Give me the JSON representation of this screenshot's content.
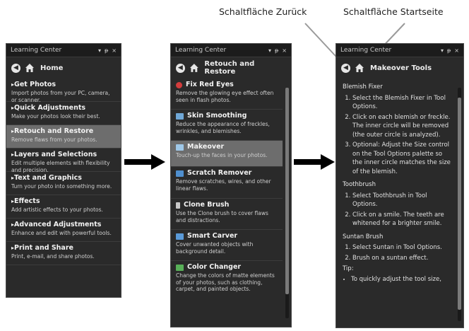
{
  "callouts": {
    "back_label": "Schaltfläche Zurück",
    "home_label": "Schaltfläche Startseite"
  },
  "panel_common": {
    "title": "Learning Center",
    "pin_glyph": "▾",
    "dock_glyph": "ᵽ",
    "close_glyph": "×"
  },
  "panel1": {
    "nav_title": "Home",
    "items": [
      {
        "title": "Get Photos",
        "desc": "Import photos from your PC, camera, or scanner."
      },
      {
        "title": "Quick Adjustments",
        "desc": "Make your photos look their best."
      },
      {
        "title": "Retouch and Restore",
        "desc": "Remove flaws from your photos."
      },
      {
        "title": "Layers and Selections",
        "desc": "Edit multiple elements with flexibility and precision."
      },
      {
        "title": "Text and Graphics",
        "desc": "Turn your photo into something more."
      },
      {
        "title": "Effects",
        "desc": "Add artistic effects to your photos."
      },
      {
        "title": "Advanced Adjustments",
        "desc": "Enhance and edit with powerful tools."
      },
      {
        "title": "Print and Share",
        "desc": "Print, e-mail, and share photos."
      }
    ]
  },
  "panel2": {
    "nav_title": "Retouch and Restore",
    "items": [
      {
        "title": "Fix Red Eyes",
        "desc": "Remove the glowing eye effect often seen in flash photos.",
        "icon": "red-eye-icon",
        "color": "#d23c3c"
      },
      {
        "title": "Skin Smoothing",
        "desc": "Reduce the appearance of freckles, wrinkles, and blemishes.",
        "icon": "skin-smoothing-icon",
        "color": "#6fa7d6"
      },
      {
        "title": "Makeover",
        "desc": "Touch-up the faces in your photos.",
        "icon": "makeover-icon",
        "color": "#9fc8e8"
      },
      {
        "title": "Scratch Remover",
        "desc": "Remove scratches, wires, and other linear flaws.",
        "icon": "scratch-remover-icon",
        "color": "#4f8fcf"
      },
      {
        "title": "Clone Brush",
        "desc": "Use the Clone brush to cover flaws and distractions.",
        "icon": "clone-brush-icon",
        "color": "#c8c8c8"
      },
      {
        "title": "Smart Carver",
        "desc": "Cover unwanted objects with background detail.",
        "icon": "smart-carver-icon",
        "color": "#5a9ad8"
      },
      {
        "title": "Color Changer",
        "desc": "Change the colors of matte elements of your photos, such as clothing, carpet, and painted objects.",
        "icon": "color-changer-icon",
        "color": "#58b058"
      }
    ]
  },
  "panel3": {
    "nav_title": "Makeover Tools",
    "section1": "Blemish Fixer",
    "steps1": [
      "Select the Blemish Fixer in Tool Options.",
      "Click on each blemish or freckle. The inner circle will be removed (the outer circle is analyzed).",
      "Optional: Adjust the Size control on the Tool Options palette so the inner circle matches the size of the blemish."
    ],
    "section2": "Toothbrush",
    "steps2": [
      "Select Toothbrush in Tool Options.",
      "Click on a smile. The teeth are whitened for a brighter smile."
    ],
    "section3": "Suntan Brush",
    "steps3": [
      "Select Suntan in Tool Options.",
      "Brush on a suntan effect."
    ],
    "tip_label": "Tip:",
    "tips": [
      "To quickly adjust the tool size,"
    ]
  },
  "colors": {
    "panel_bg": "#2a2a2a",
    "selected_bg": "#6d6d6d",
    "arrow": "#000000"
  }
}
